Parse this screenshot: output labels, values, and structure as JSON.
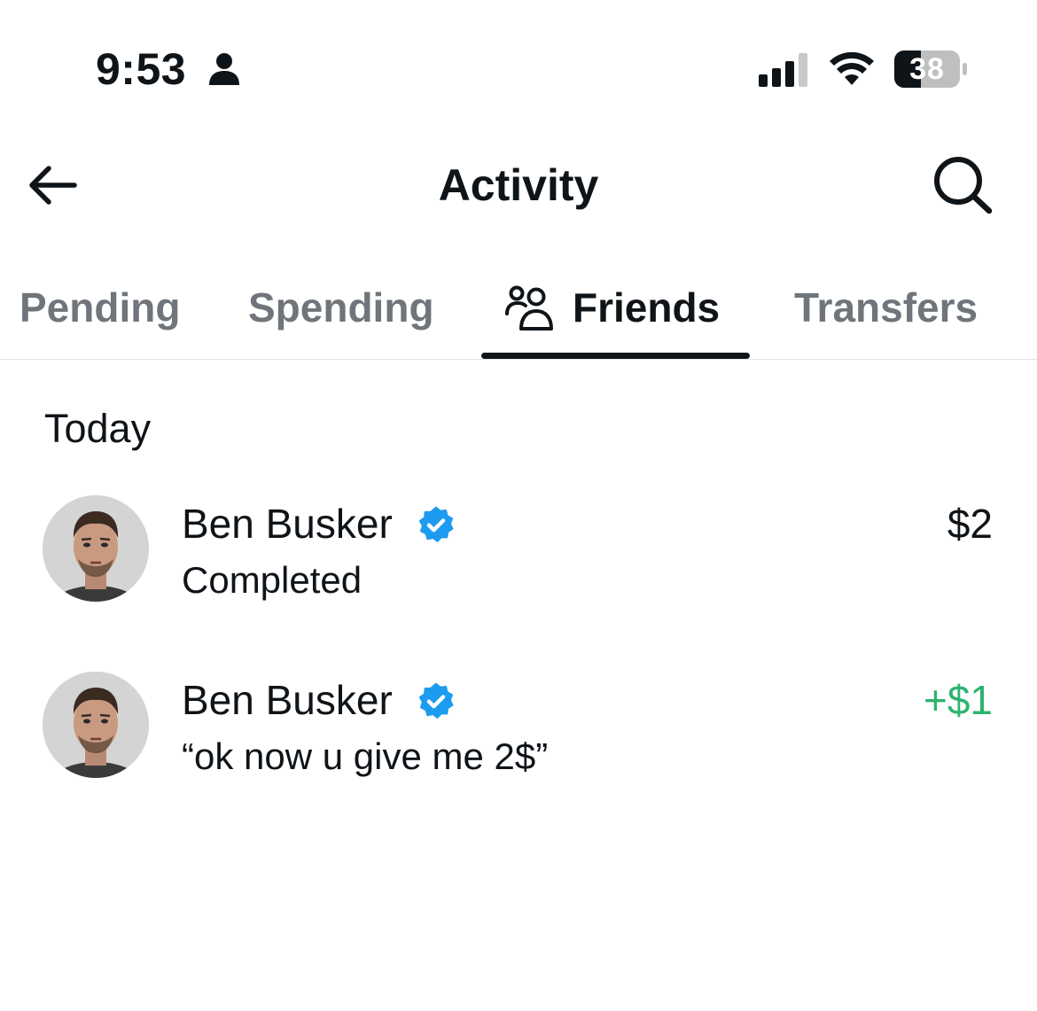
{
  "status_bar": {
    "time": "9:53",
    "battery": "38",
    "icons": [
      "person-icon",
      "signal-icon",
      "wifi-icon",
      "battery-icon"
    ]
  },
  "header": {
    "title": "Activity",
    "back_icon": "back-arrow-icon",
    "search_icon": "search-icon"
  },
  "tabs": [
    {
      "label": "Pending",
      "active": false
    },
    {
      "label": "Spending",
      "active": false
    },
    {
      "label": "Friends",
      "active": true,
      "icon": "friends-icon"
    },
    {
      "label": "Transfers",
      "active": false
    }
  ],
  "section": {
    "title": "Today"
  },
  "activities": [
    {
      "name": "Ben Busker",
      "verified": true,
      "subtitle": "Completed",
      "amount": "$2",
      "amount_color": "#0f1419"
    },
    {
      "name": "Ben Busker",
      "verified": true,
      "subtitle": "“ok now u give me 2$”",
      "amount": "+$1",
      "amount_color": "#2db36f"
    }
  ],
  "colors": {
    "text_primary": "#0f1419",
    "text_secondary": "#6f757a",
    "verified_blue": "#1d9bf0",
    "positive_green": "#2db36f",
    "divider": "#dfe3e6"
  }
}
